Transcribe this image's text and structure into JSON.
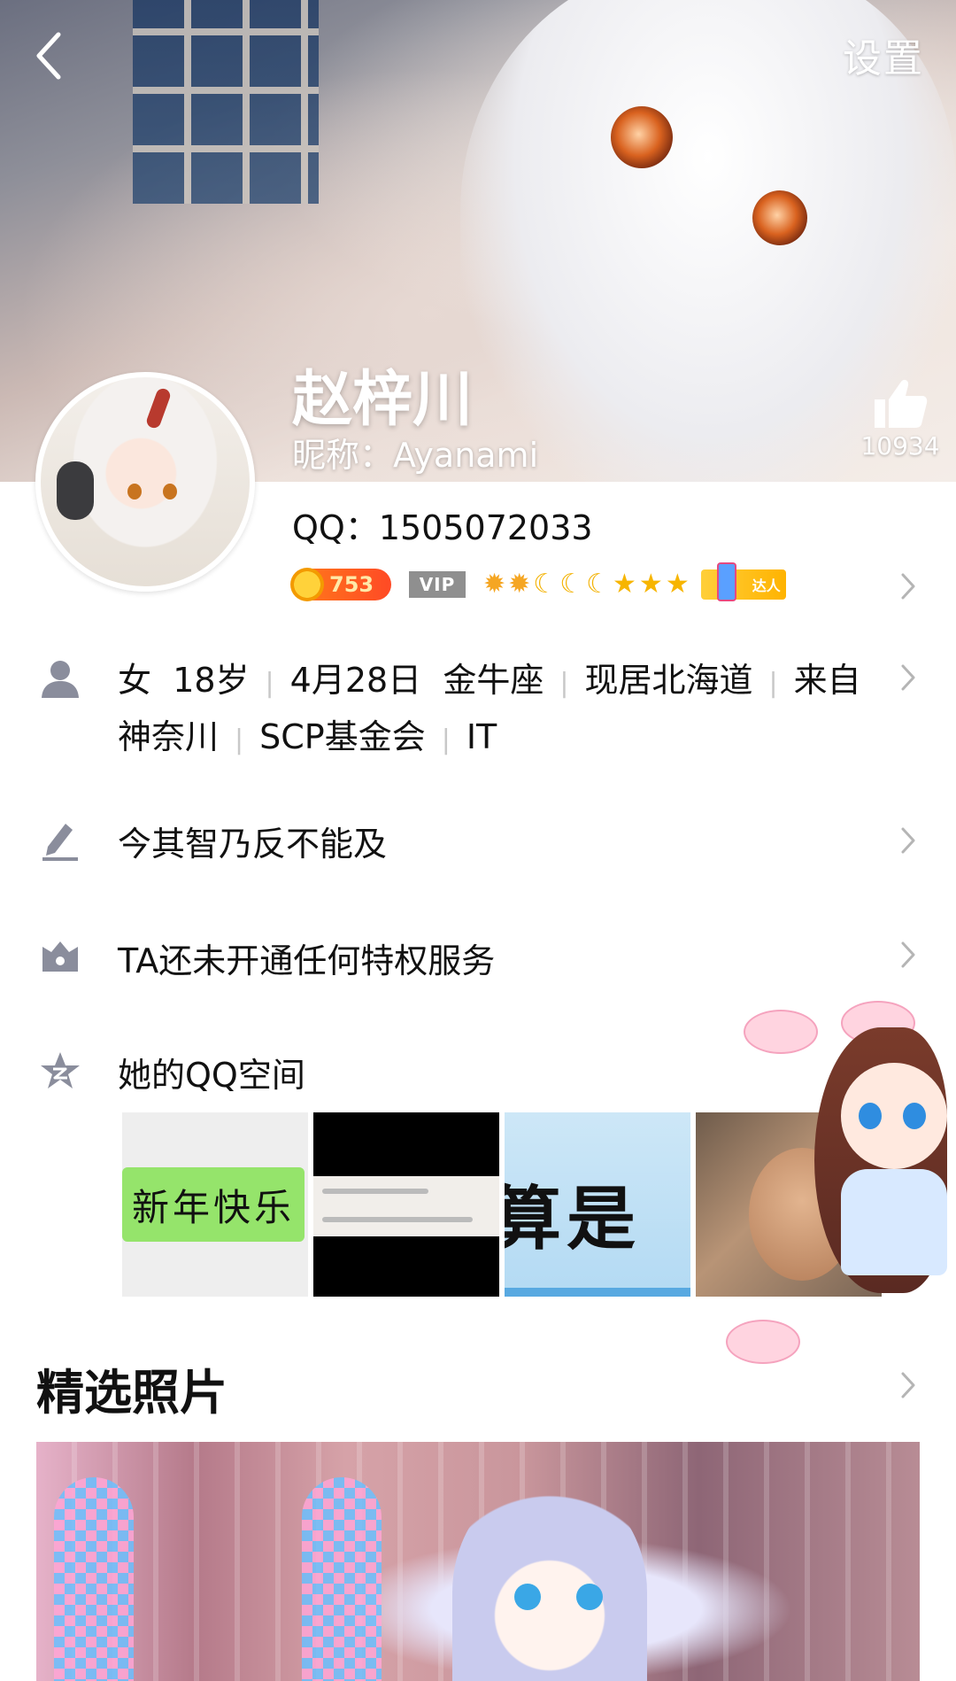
{
  "header": {
    "settings_label": "设置",
    "name": "赵梓川",
    "nickname": "昵称：Ayanami",
    "likes": "10934"
  },
  "profile": {
    "qq": "QQ：1505072033",
    "coin_level": "753",
    "vip_label": "VIP",
    "level_icons": [
      "sun-icon",
      "sun-icon",
      "moon-icon",
      "moon-icon",
      "moon-icon",
      "star-icon",
      "star-icon",
      "star-icon"
    ],
    "talent_badge": "达人"
  },
  "info": {
    "gender": "女",
    "age": "18岁",
    "birthday": "4月28日",
    "zodiac": "金牛座",
    "residence": "现居北海道",
    "hometown": "来自神奈川",
    "company": "SCP基金会",
    "occupation": "IT"
  },
  "signature": "今其智乃反不能及",
  "privilege": "TA还未开通任何特权服务",
  "qzone": {
    "label": "她的QQ空间",
    "thumb1_text": "新年快乐",
    "thumb3_text": "算是"
  },
  "featured": {
    "title": "精选照片"
  },
  "colors": {
    "accent_coin": "#ff5a24",
    "vip_gray": "#8f8f8f",
    "icon_gray": "#8a8d9c",
    "chevron": "#b5b5b5"
  }
}
